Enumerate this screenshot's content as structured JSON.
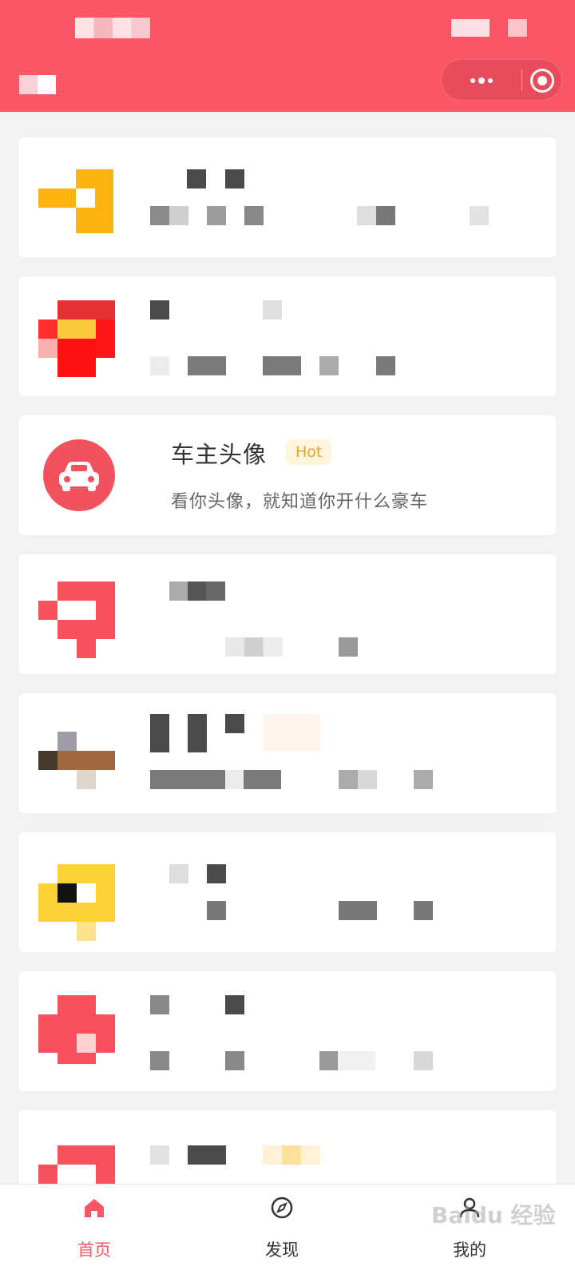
{
  "colors": {
    "brand": "#fb5665",
    "hot_text": "#e8a32e",
    "hot_bg": "#fff5dd",
    "text_primary": "#333333",
    "text_secondary": "#666666"
  },
  "header": {
    "capsule": {
      "more_icon": "more-dots-icon",
      "close_icon": "target-close-icon"
    }
  },
  "featured_card": {
    "icon": "car-icon",
    "title": "车主头像",
    "badge": "Hot",
    "description": "看你头像，就知道你开什么豪车"
  },
  "tabbar": {
    "tabs": [
      {
        "label": "首页",
        "icon": "home-icon",
        "active": true
      },
      {
        "label": "发现",
        "icon": "compass-icon",
        "active": false
      },
      {
        "label": "我的",
        "icon": "user-icon",
        "active": false
      }
    ]
  },
  "watermark": {
    "text": "Baidu 经验"
  }
}
